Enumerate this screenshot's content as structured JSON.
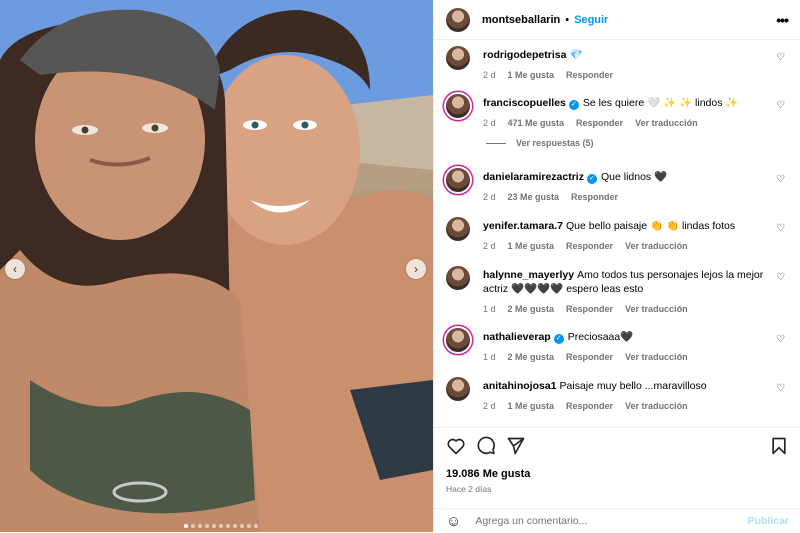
{
  "post": {
    "username": "montseballarin",
    "separator": "•",
    "follow_label": "Seguir",
    "more_label": "•••",
    "prev_label": "‹",
    "next_label": "›"
  },
  "comments": [
    {
      "username": "rodrigodepetrisa",
      "text": "💎",
      "verified": false,
      "time": "2 d",
      "likes": "1 Me gusta",
      "reply": "Responder",
      "translate": ""
    },
    {
      "username": "franciscopuelles",
      "text": "Se les quiere 🤍 ✨ ✨ lindos ✨",
      "verified": true,
      "time": "2 d",
      "likes": "471 Me gusta",
      "reply": "Responder",
      "translate": "Ver traducción"
    },
    {
      "username": "danielaramirezactriz",
      "text": "Que lidnos 🖤",
      "verified": true,
      "time": "2 d",
      "likes": "23 Me gusta",
      "reply": "Responder",
      "translate": ""
    },
    {
      "username": "yenifer.tamara.7",
      "text": "Que bello paisaje 👏 👏 lindas fotos",
      "verified": false,
      "time": "2 d",
      "likes": "1 Me gusta",
      "reply": "Responder",
      "translate": "Ver traducción"
    },
    {
      "username": "halynne_mayerlyy",
      "text": "Amo todos tus personajes lejos la mejor actriz 🖤🖤🖤🖤 espero leas esto",
      "verified": false,
      "time": "1 d",
      "likes": "2 Me gusta",
      "reply": "Responder",
      "translate": "Ver traducción"
    },
    {
      "username": "nathalieverap",
      "text": "Preciosaaa🖤",
      "verified": true,
      "time": "1 d",
      "likes": "2 Me gusta",
      "reply": "Responder",
      "translate": "Ver traducción"
    },
    {
      "username": "anitahinojosa1",
      "text": "Paisaje muy bello ...maravilloso",
      "verified": false,
      "time": "2 d",
      "likes": "1 Me gusta",
      "reply": "Responder",
      "translate": "Ver traducción"
    }
  ],
  "replies_label": "Ver respuestas (5)",
  "footer": {
    "likes": "19.086 Me gusta",
    "date": "Hace 2 días",
    "comment_placeholder": "Agrega un comentario...",
    "publish_label": "Publicar"
  },
  "colors": {
    "accent": "#0095f6",
    "muted": "#737373"
  }
}
